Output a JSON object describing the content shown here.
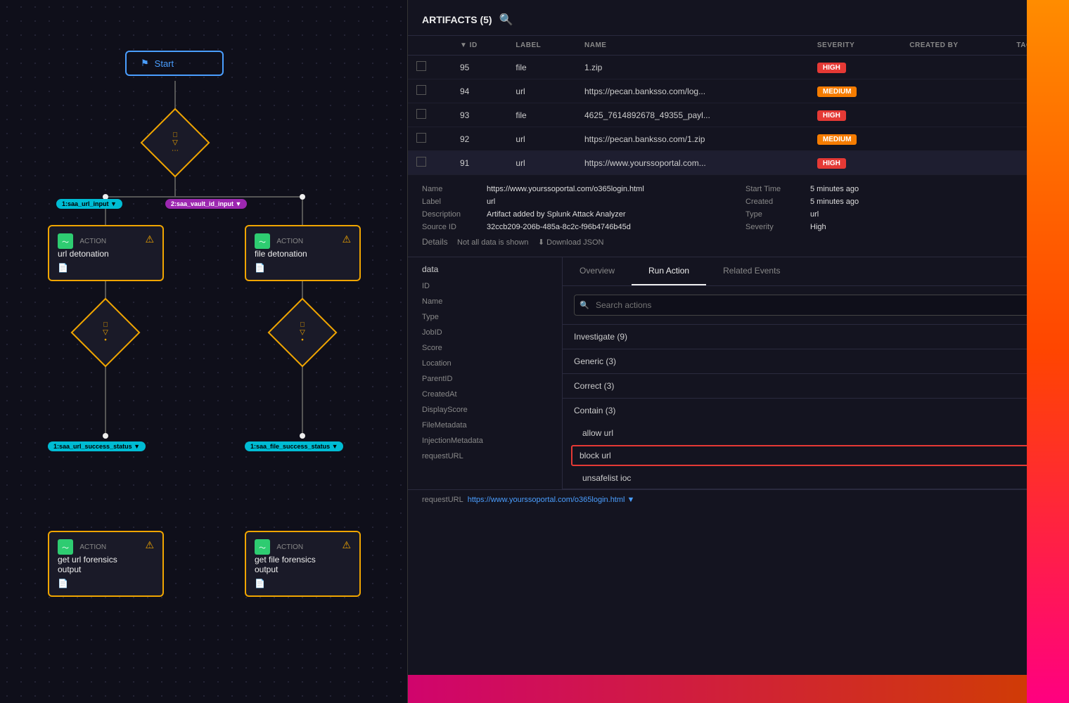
{
  "canvas": {
    "start_label": "Start",
    "filter_label": "▽",
    "nodes": [
      {
        "id": "url-detonation",
        "type": "ACTION",
        "title": "url detonation",
        "input": "1:saa_url_input ▼",
        "input2": "2:saa_vault_id_input ▼"
      },
      {
        "id": "file-detonation",
        "type": "ACTION",
        "title": "file detonation"
      },
      {
        "id": "url-forensics",
        "type": "ACTION",
        "title": "get url forensics\noutput",
        "status": "1:saa_url_success_status ▼"
      },
      {
        "id": "file-forensics",
        "type": "ACTION",
        "title": "get file forensics\noutput",
        "status": "1:saa_file_success_status ▼"
      }
    ]
  },
  "artifacts": {
    "title": "ARTIFACTS (5)",
    "columns": [
      "",
      "▼ ID",
      "LABEL",
      "NAME",
      "SEVERITY",
      "CREATED BY",
      "TAGS"
    ],
    "rows": [
      {
        "id": "95",
        "label": "file",
        "name": "1.zip",
        "severity": "HIGH",
        "severity_class": "severity-high",
        "created_by": "",
        "tags": ""
      },
      {
        "id": "94",
        "label": "url",
        "name": "https://pecan.banksso.com/log...",
        "severity": "MEDIUM",
        "severity_class": "severity-medium",
        "created_by": "",
        "tags": ""
      },
      {
        "id": "93",
        "label": "file",
        "name": "4625_7614892678_49355_payl...",
        "severity": "HIGH",
        "severity_class": "severity-high",
        "created_by": "",
        "tags": ""
      },
      {
        "id": "92",
        "label": "url",
        "name": "https://pecan.banksso.com/1.zip",
        "severity": "MEDIUM",
        "severity_class": "severity-medium",
        "created_by": "",
        "tags": ""
      },
      {
        "id": "91",
        "label": "url",
        "name": "https://www.yourssoportal.com...",
        "severity": "HIGH",
        "severity_class": "severity-high",
        "created_by": "",
        "tags": ""
      }
    ]
  },
  "detail": {
    "name_label": "Name",
    "name_value": "https://www.yourssoportal.com/o365login.html",
    "label_label": "Label",
    "label_value": "url",
    "description_label": "Description",
    "description_value": "Artifact added by Splunk Attack Analyzer",
    "source_id_label": "Source ID",
    "source_id_value": "32ccb209-206b-485a-8c2c-f96b4746b45d",
    "start_time_label": "Start Time",
    "start_time_value": "5 minutes ago",
    "created_label": "Created",
    "created_value": "5 minutes ago",
    "type_label": "Type",
    "type_value": "url",
    "severity_label": "Severity",
    "severity_value": "High",
    "details_title": "Details",
    "not_all_data": "Not all data is shown",
    "download_json": "⬇ Download JSON"
  },
  "data_section": {
    "title": "data",
    "fields": [
      "ID",
      "Name",
      "Type",
      "JobID",
      "Score",
      "Location",
      "ParentID",
      "CreatedAt",
      "DisplayScore",
      "FileMetadata",
      "InjectionMetadata",
      "requestURL"
    ]
  },
  "tabs": {
    "overview": "Overview",
    "run_action": "Run Action",
    "related_events": "Related Events"
  },
  "run_action": {
    "search_placeholder": "Search actions",
    "groups": [
      {
        "name": "Investigate (9)",
        "count": 9,
        "expanded": false
      },
      {
        "name": "Generic (3)",
        "count": 3,
        "expanded": false
      },
      {
        "name": "Correct (3)",
        "count": 3,
        "expanded": false
      },
      {
        "name": "Contain (3)",
        "count": 3,
        "expanded": true,
        "items": [
          "allow url",
          "block url",
          "unsafelist ioc"
        ]
      }
    ]
  },
  "url_bar": {
    "label": "requestURL",
    "value": "https://www.yourssoportal.com/o365login.html ▼"
  }
}
